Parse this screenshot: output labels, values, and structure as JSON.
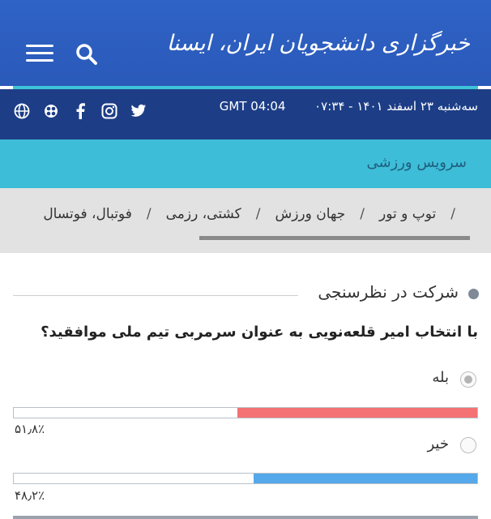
{
  "header": {
    "logo_text": "خبرگزاری دانشجویان ایران، ایسنا",
    "date_text": "سه‌شنبه ۲۳ اسفند ۱۴۰۱ - ۰۷:۳۴",
    "gmt_text": "GMT 04:04"
  },
  "social_icons": [
    "twitter-icon",
    "instagram-icon",
    "facebook-icon",
    "aparat-icon",
    "globe-icon"
  ],
  "service": {
    "label": "سرویس ورزشی"
  },
  "categories": [
    {
      "label": "فوتبال، فوتسال"
    },
    {
      "label": "کشتی، رزمی"
    },
    {
      "label": "جهان ورزش"
    },
    {
      "label": "توپ و تور"
    }
  ],
  "category_separator": "/",
  "poll": {
    "title": "شرکت در نظرسنجی",
    "question": "با انتخاب امیر قلعه‌نویی به عنوان سرمربی تیم ملی موافقید؟",
    "options": [
      {
        "label": "بله",
        "percent_text": "۵۱٫۸٪",
        "percent": 51.8,
        "color": "#f47174",
        "selected": true
      },
      {
        "label": "خیر",
        "percent_text": "۴۸٫۲٪",
        "percent": 48.2,
        "color": "#55a8ea",
        "selected": false
      }
    ]
  },
  "colors": {
    "header_blue": "#2f63c6",
    "dark_blue": "#1d3e86",
    "teal": "#3dbdd8",
    "category_bg": "#e2e2e2"
  }
}
